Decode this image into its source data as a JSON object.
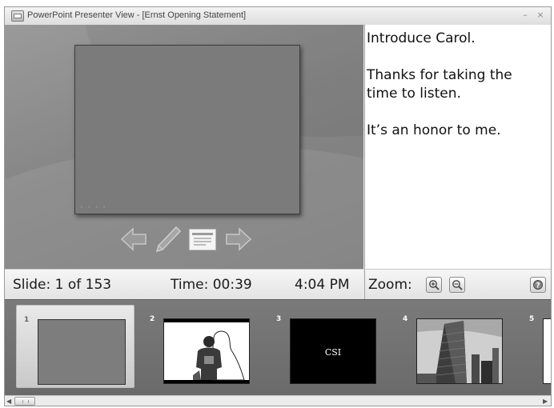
{
  "window": {
    "title": "PowerPoint Presenter View - [Ernst Opening Statement]",
    "minimize_glyph": "–",
    "close_glyph": "×",
    "app_icon": "presenter-app-icon"
  },
  "slide_view": {
    "nav_icons": [
      "previous-arrow-icon",
      "pen-icon",
      "slide-menu-icon",
      "next-arrow-icon"
    ]
  },
  "notes": {
    "lines": [
      "Introduce Carol.",
      "Thanks for taking the time to listen.",
      "It’s an honor to me."
    ]
  },
  "status": {
    "slide_label": "Slide: 1 of 153",
    "time_label": "Time: 00:39",
    "clock": "4:04 PM",
    "zoom_label": "Zoom:",
    "zoom_icons": [
      "zoom-in-icon",
      "zoom-out-icon",
      "help-icon"
    ]
  },
  "thumbnails": [
    {
      "number": "1",
      "style": "gray"
    },
    {
      "number": "2",
      "style": "photo-person"
    },
    {
      "number": "3",
      "style": "black",
      "caption": "CSI"
    },
    {
      "number": "4",
      "style": "photo-building"
    },
    {
      "number": "5",
      "style": "white"
    }
  ],
  "scrollbar": {
    "left_arrow": "◀",
    "right_arrow": "▶"
  },
  "colors": {
    "slide_background": "#868686",
    "thumb_strip": "#717171",
    "notes_background": "#ffffff"
  }
}
